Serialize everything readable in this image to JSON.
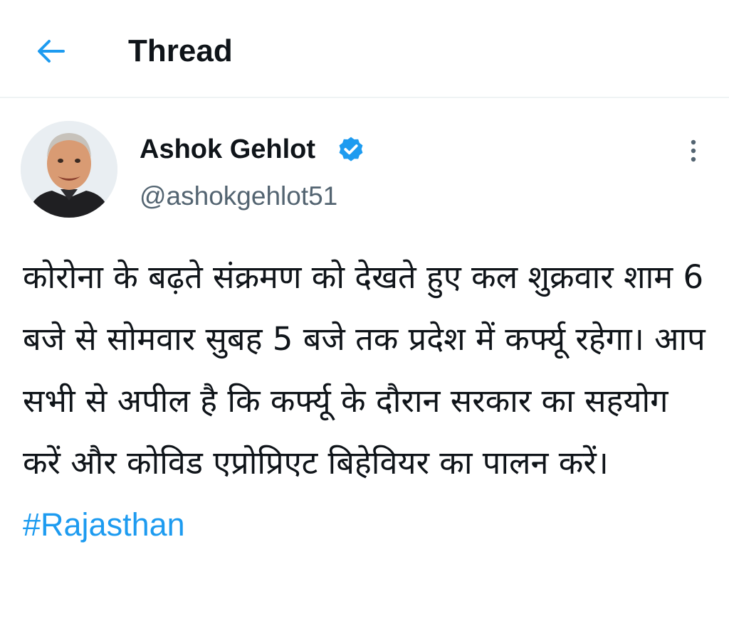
{
  "header": {
    "back_icon": "back-arrow-icon",
    "title": "Thread"
  },
  "tweet": {
    "author": {
      "name": "Ashok Gehlot",
      "verified": true,
      "verified_icon": "verified-badge-icon",
      "handle": "@ashokgehlot51"
    },
    "more_icon": "more-vertical-icon",
    "text": "कोरोना के बढ़ते संक्रमण को देखते हुए कल शुक्रवार शाम 6 बजे से सोमवार सुबह 5 बजे तक प्रदेश में कर्फ्यू रहेगा। आप सभी से अपील है कि कर्फ्यू के दौरान सरकार का सहयोग करें और कोविड एप्रोप्रिएट बिहेवियर का पालन करें।",
    "hashtag": "#Rajasthan"
  },
  "colors": {
    "accent": "#1d9bf0",
    "text_primary": "#0f1419",
    "text_secondary": "#536471",
    "divider": "#eff3f4"
  }
}
